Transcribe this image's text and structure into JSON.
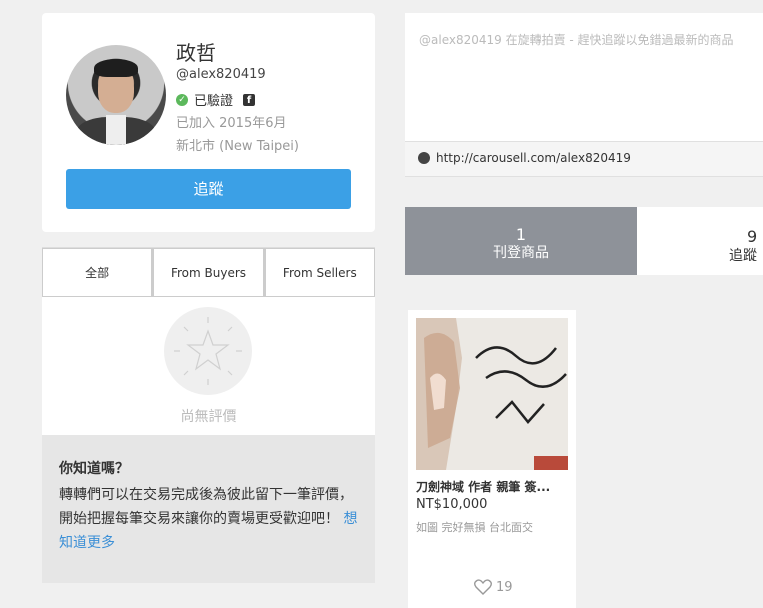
{
  "profile": {
    "name": "政哲",
    "username": "@alex820419",
    "verified": "已驗證",
    "joined": "已加入 2015年6月",
    "location": "新北市 (New Taipei)",
    "follow_button": "追蹤"
  },
  "reviews": {
    "tabs": [
      {
        "label": "全部"
      },
      {
        "label": "From Buyers"
      },
      {
        "label": "From Sellers"
      }
    ],
    "empty_text": "尚無評價"
  },
  "tip": {
    "title": "你知道嗎？",
    "body": "轉轉們可以在交易完成後為彼此留下一筆評價，開始把握每筆交易來讓你的賣場更受歡迎吧！",
    "link": "想知道更多"
  },
  "description": "@alex820419 在旋轉拍賣 - 趕快追蹤以免錯過最新的商品",
  "url": "http://carousell.com/alex820419",
  "stats": {
    "listings": {
      "count": "1",
      "label": "刊登商品"
    },
    "following": {
      "count": "9",
      "label": "追蹤"
    }
  },
  "product": {
    "title": "刀劍神域 作者 親筆 簽...",
    "price": "NT$10,000",
    "meta": "如圖 完好無損 台北面交",
    "likes": "19"
  },
  "colors": {
    "accent": "#3ba0e6",
    "active_tab": "#8e9299",
    "link": "#3b8fd6"
  }
}
